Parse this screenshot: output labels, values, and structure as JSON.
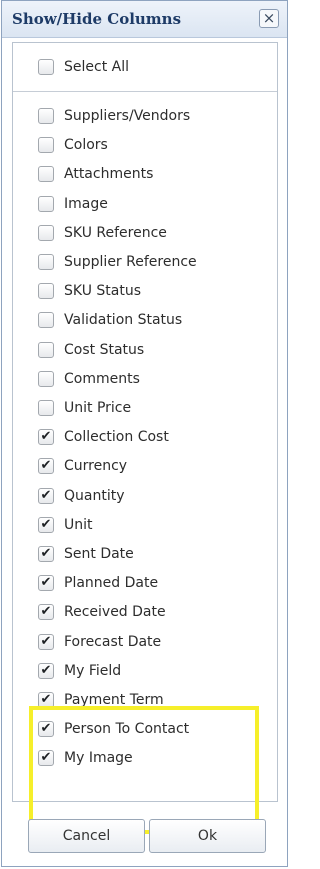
{
  "dialog": {
    "title": "Show/Hide Columns",
    "close_label": "×",
    "select_all": {
      "label": "Select All",
      "checked": false
    },
    "items": [
      {
        "label": "Suppliers/Vendors",
        "checked": false
      },
      {
        "label": "Colors",
        "checked": false
      },
      {
        "label": "Attachments",
        "checked": false
      },
      {
        "label": "Image",
        "checked": false
      },
      {
        "label": "SKU Reference",
        "checked": false
      },
      {
        "label": "Supplier Reference",
        "checked": false
      },
      {
        "label": "SKU Status",
        "checked": false
      },
      {
        "label": "Validation Status",
        "checked": false
      },
      {
        "label": "Cost Status",
        "checked": false
      },
      {
        "label": "Comments",
        "checked": false
      },
      {
        "label": "Unit Price",
        "checked": false
      },
      {
        "label": "Collection Cost",
        "checked": true
      },
      {
        "label": "Currency",
        "checked": true
      },
      {
        "label": "Quantity",
        "checked": true
      },
      {
        "label": "Unit",
        "checked": true
      },
      {
        "label": "Sent Date",
        "checked": true
      },
      {
        "label": "Planned Date",
        "checked": true
      },
      {
        "label": "Received Date",
        "checked": true
      },
      {
        "label": "Forecast Date",
        "checked": true
      },
      {
        "label": "My Field",
        "checked": true
      },
      {
        "label": "Payment Term",
        "checked": true
      },
      {
        "label": "Person To Contact",
        "checked": true
      },
      {
        "label": "My Image",
        "checked": true
      }
    ],
    "cancel_label": "Cancel",
    "ok_label": "Ok",
    "highlight_color": "#f6ef2a"
  }
}
